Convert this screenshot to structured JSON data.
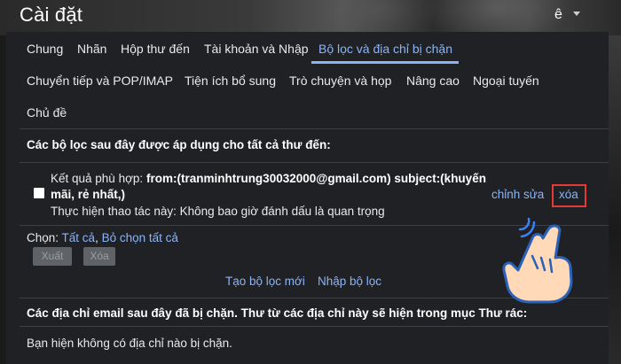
{
  "header": {
    "title": "Cài đặt",
    "language_label": "ê"
  },
  "tabs": [
    {
      "label": "Chung"
    },
    {
      "label": "Nhãn"
    },
    {
      "label": "Hộp thư đến"
    },
    {
      "label": "Tài khoản và Nhập"
    },
    {
      "label": "Bộ lọc và địa chỉ bị chặn",
      "active": true
    },
    {
      "label": "Chuyển tiếp và POP/IMAP"
    },
    {
      "label": "Tiện ích bổ sung"
    },
    {
      "label": "Trò chuyện và họp"
    },
    {
      "label": "Nâng cao"
    },
    {
      "label": "Ngoại tuyến"
    },
    {
      "label": "Chủ đề"
    }
  ],
  "filters": {
    "heading": "Các bộ lọc sau đây được áp dụng cho tất cả thư đến:",
    "items": [
      {
        "match_label": "Kết quả phù hợp:",
        "criteria_line1": "from:(tranminhtrung30032000@gmail.com) subject:(khuyến",
        "criteria_line2": "mãi, rẻ nhất,)",
        "action_line": "Thực hiện thao tác này: Không bao giờ đánh dấu là quan trọng",
        "edit_label": "chỉnh sửa",
        "delete_label": "xóa"
      }
    ],
    "select_label": "Chọn:",
    "select_all": "Tất cả",
    "select_separator": ",",
    "select_none": "Bỏ chọn tất cả",
    "export_label": "Xuất",
    "delete_button_label": "Xóa",
    "create_new": "Tạo bộ lọc mới",
    "import": "Nhập bộ lọc"
  },
  "blocked": {
    "heading": "Các địa chỉ email sau đây đã bị chặn. Thư từ các địa chỉ này sẽ hiện trong mục Thư rác:",
    "empty_message": "Bạn hiện không có địa chỉ nào bị chặn."
  },
  "colors": {
    "accent": "#8ab4f8",
    "highlight_box": "#e53935"
  },
  "icons": {
    "pointer": "pointing-hand-icon",
    "dropdown": "chevron-down-icon"
  }
}
